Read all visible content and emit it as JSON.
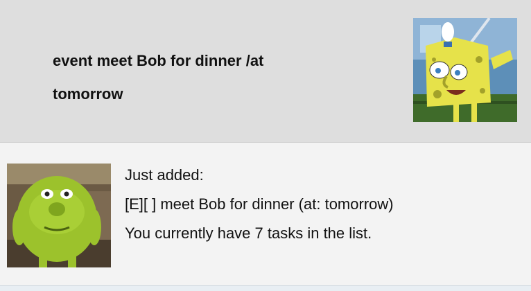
{
  "user_message": {
    "text": "event meet Bob for dinner /at\ntomorrow",
    "avatar_icon": "spongebob-avatar-icon"
  },
  "bot_message": {
    "lines": [
      "Just added:",
      "[E][ ] meet Bob for dinner (at: tomorrow)",
      "You currently have 7 tasks in the list."
    ],
    "avatar_icon": "mike-wazowski-avatar-icon"
  },
  "colors": {
    "user_bg": "#dedede",
    "bot_bg": "#f3f3f3",
    "text": "#111111"
  }
}
